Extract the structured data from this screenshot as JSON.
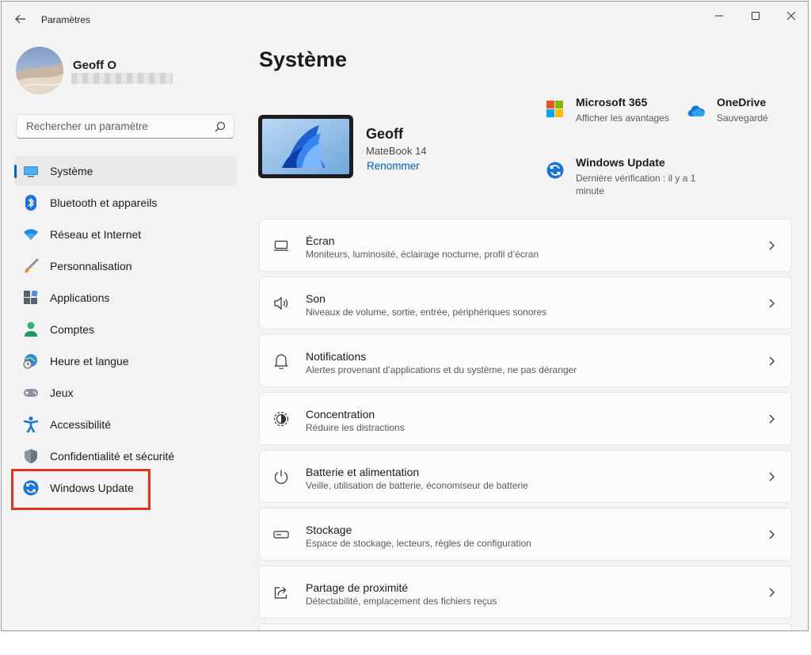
{
  "window": {
    "title": "Paramètres"
  },
  "profile": {
    "name": "Geoff O"
  },
  "search": {
    "placeholder": "Rechercher un paramètre"
  },
  "sidebar": {
    "items": [
      {
        "label": "Système",
        "icon": "monitor-icon",
        "active": true
      },
      {
        "label": "Bluetooth et appareils",
        "icon": "bluetooth-icon"
      },
      {
        "label": "Réseau et Internet",
        "icon": "wifi-icon"
      },
      {
        "label": "Personnalisation",
        "icon": "brush-icon"
      },
      {
        "label": "Applications",
        "icon": "apps-icon"
      },
      {
        "label": "Comptes",
        "icon": "person-icon"
      },
      {
        "label": "Heure et langue",
        "icon": "globe-clock-icon"
      },
      {
        "label": "Jeux",
        "icon": "gamepad-icon"
      },
      {
        "label": "Accessibilité",
        "icon": "accessibility-icon"
      },
      {
        "label": "Confidentialité et sécurité",
        "icon": "shield-icon"
      },
      {
        "label": "Windows Update",
        "icon": "sync-icon",
        "highlighted": true
      }
    ]
  },
  "main": {
    "title": "Système",
    "device": {
      "name": "Geoff",
      "model": "MateBook 14",
      "rename": "Renommer"
    },
    "tiles": {
      "m365": {
        "title": "Microsoft 365",
        "subtitle": "Afficher les avantages",
        "icon": "microsoft-logo-icon"
      },
      "onedrive": {
        "title": "OneDrive",
        "subtitle": "Sauvegardé",
        "icon": "cloud-icon"
      },
      "update": {
        "title": "Windows Update",
        "subtitle_line1": "Dernière vérification : il y a 1",
        "subtitle_line2": "minute",
        "icon": "sync-icon"
      }
    },
    "cards": [
      {
        "title": "Écran",
        "desc": "Moniteurs, luminosité, éclairage nocturne, profil d’écran",
        "icon": "display-icon"
      },
      {
        "title": "Son",
        "desc": "Niveaux de volume, sortie, entrée, périphériques sonores",
        "icon": "speaker-icon"
      },
      {
        "title": "Notifications",
        "desc": "Alertes provenant d’applications et du système, ne pas déranger",
        "icon": "bell-icon"
      },
      {
        "title": "Concentration",
        "desc": "Réduire les distractions",
        "icon": "focus-icon"
      },
      {
        "title": "Batterie et alimentation",
        "desc": "Veille, utilisation de batterie, économiseur de batterie",
        "icon": "power-icon"
      },
      {
        "title": "Stockage",
        "desc": "Espace de stockage, lecteurs, règles de configuration",
        "icon": "storage-icon"
      },
      {
        "title": "Partage de proximité",
        "desc": "Détectabilité, emplacement des fichiers reçus",
        "icon": "share-icon"
      }
    ]
  },
  "colors": {
    "accent": "#0067c0",
    "link": "#005fb8",
    "highlight": "#e3331f"
  }
}
